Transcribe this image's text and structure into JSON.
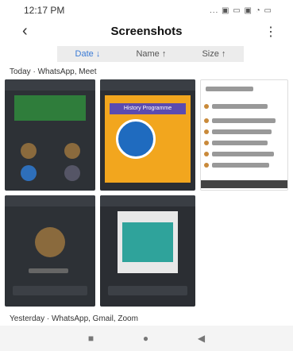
{
  "status_bar": {
    "time": "12:17 PM",
    "icons": "... ▣ ▭ ▣ ◔ ▭"
  },
  "app_bar": {
    "back_icon": "back-arrow-icon",
    "title": "Screenshots",
    "more_icon": "more-vert-icon"
  },
  "sort_bar": {
    "date": "Date ↓",
    "name": "Name ↑",
    "size": "Size ↑"
  },
  "sections": [
    {
      "label": "Today · WhatsApp, Meet"
    },
    {
      "label": "Yesterday · WhatsApp, Gmail, Zoom"
    }
  ],
  "thumbnails": {
    "t2": {
      "poster_title": "History Programme"
    }
  },
  "nav_bar": {
    "recents_icon": "recents-square-icon",
    "home_icon": "home-circle-icon",
    "back_icon": "back-triangle-icon"
  }
}
